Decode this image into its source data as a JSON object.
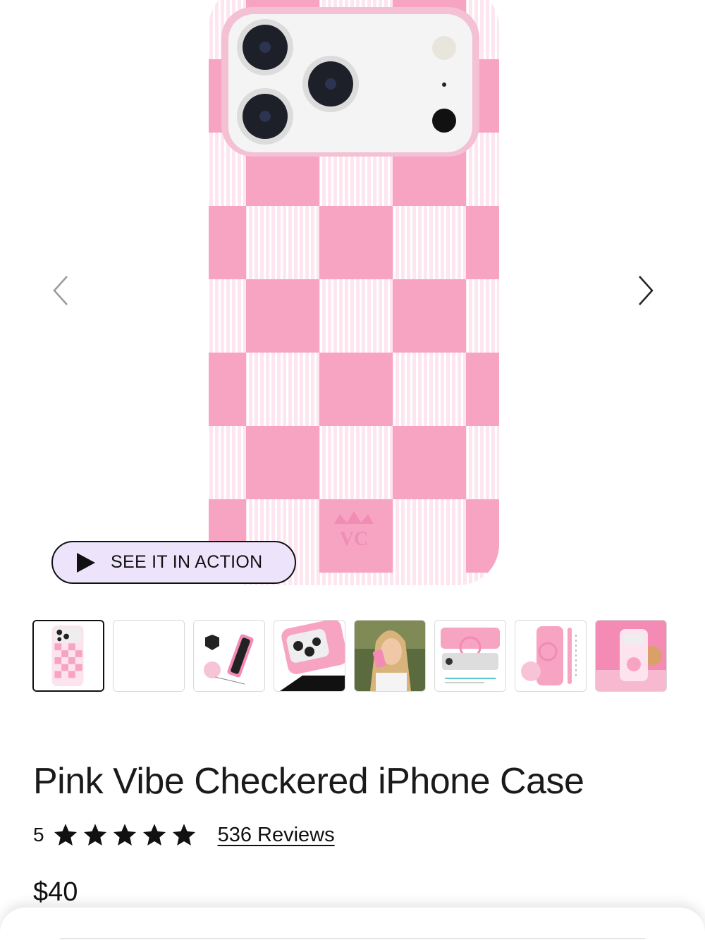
{
  "gallery": {
    "image_icon": "pink-checkered-phone-case-image",
    "prev_icon": "chevron-left-icon",
    "next_icon": "chevron-right-icon",
    "video_button": {
      "icon": "play-icon",
      "label": "SEE IT IN ACTION"
    },
    "thumbnails_count": 8,
    "active_thumbnail": 0
  },
  "product": {
    "title": "Pink Vibe Checkered iPhone Case",
    "rating": "5",
    "stars": 5,
    "reviews_label": "536 Reviews",
    "price": "$40"
  },
  "colors": {
    "case_pink": "#f7a4c3",
    "case_light": "#fde3ee",
    "button_bg": "#ede3fb",
    "text": "#1a1a1a"
  }
}
